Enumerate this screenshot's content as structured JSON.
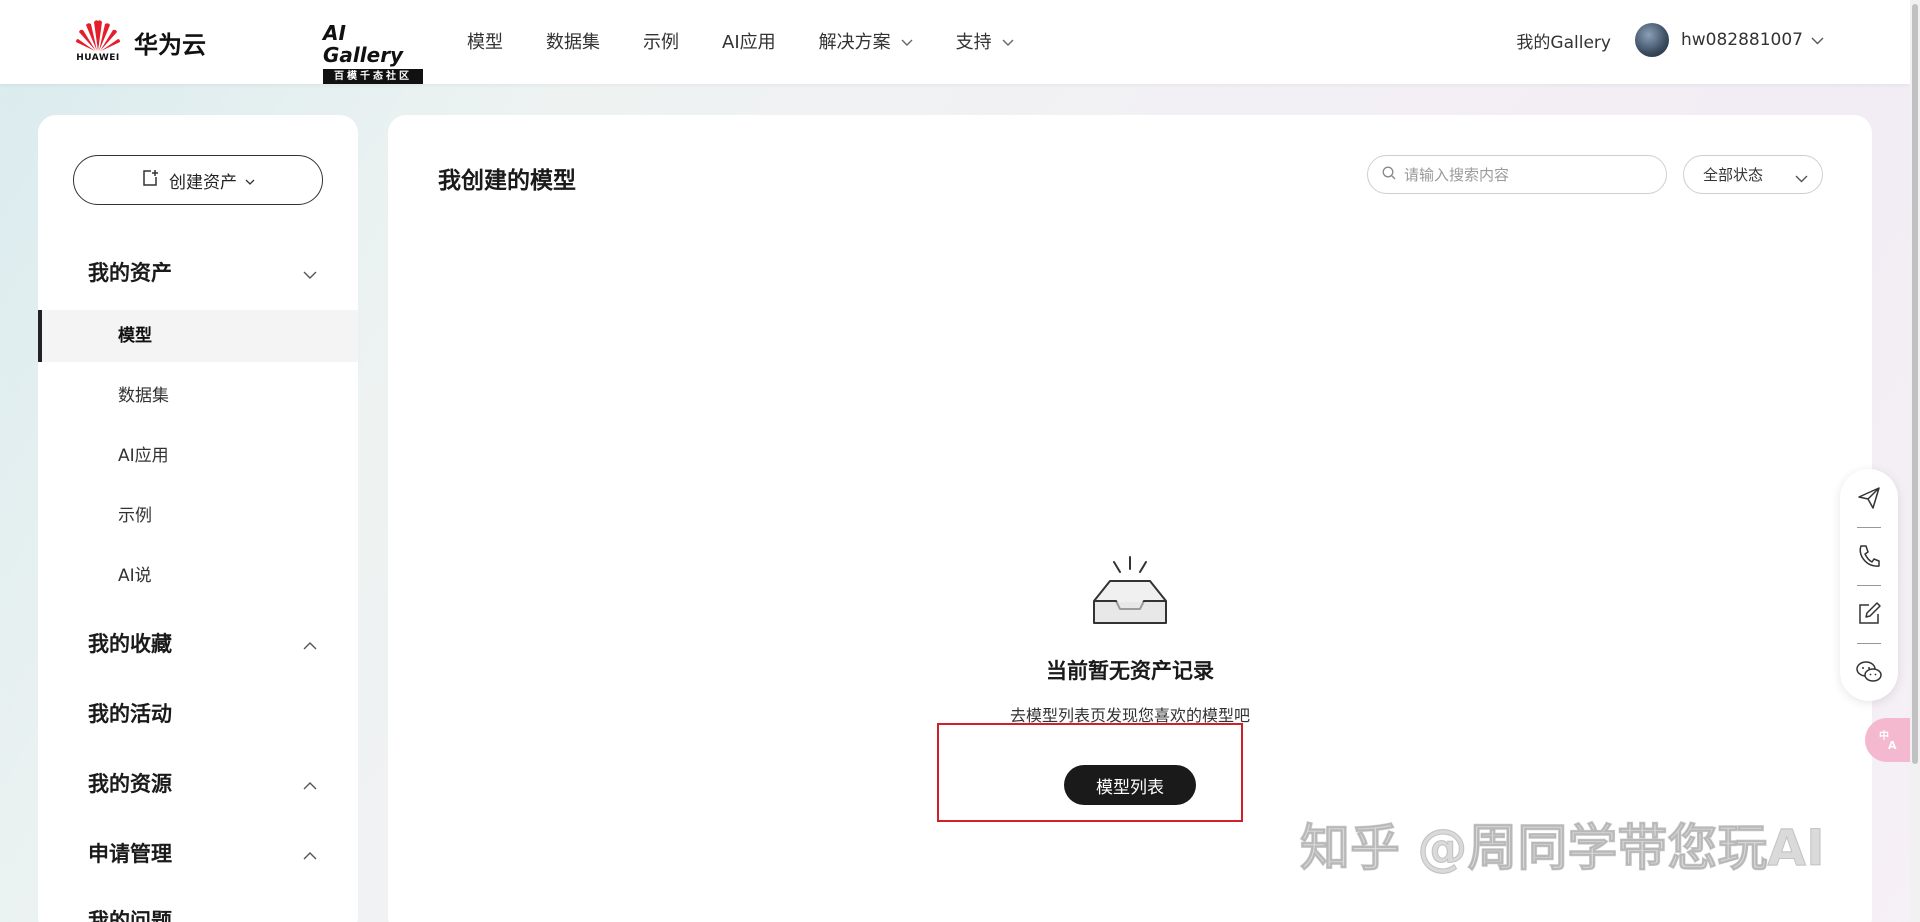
{
  "header": {
    "brand_text": "华为云",
    "brand_word": "HUAWEI",
    "gallery_title": "AI Gallery",
    "gallery_subtitle": "百模千态社区",
    "nav": [
      {
        "label": "模型"
      },
      {
        "label": "数据集"
      },
      {
        "label": "示例"
      },
      {
        "label": "AI应用"
      },
      {
        "label": "解决方案"
      },
      {
        "label": "支持"
      }
    ],
    "my_gallery": "我的Gallery",
    "username": "hw082881007"
  },
  "sidebar": {
    "create_label": "创建资产",
    "sections": [
      {
        "title": "我的资产",
        "expanded": true
      },
      {
        "title": "我的收藏",
        "expanded": false
      },
      {
        "title": "我的活动"
      },
      {
        "title": "我的资源",
        "expanded": false
      },
      {
        "title": "申请管理",
        "expanded": false
      },
      {
        "title": "我的问题"
      }
    ],
    "asset_items": [
      {
        "label": "模型",
        "active": true
      },
      {
        "label": "数据集"
      },
      {
        "label": "AI应用"
      },
      {
        "label": "示例"
      },
      {
        "label": "AI说"
      }
    ]
  },
  "main": {
    "title": "我创建的模型",
    "search_placeholder": "请输入搜索内容",
    "status_filter": "全部状态",
    "empty_title": "当前暂无资产记录",
    "empty_subtitle": "去模型列表页发现您喜欢的模型吧",
    "list_button": "模型列表"
  },
  "float_tools": [
    "send-icon",
    "phone-icon",
    "edit-icon",
    "wechat-icon"
  ],
  "translate_icon": "translate-icon",
  "watermark": "知乎 @周同学带您玩AI",
  "colors": {
    "accent_dark": "#1a1a1a",
    "highlight_red": "#d0202a",
    "translate_pink": "#f4b8cf"
  }
}
